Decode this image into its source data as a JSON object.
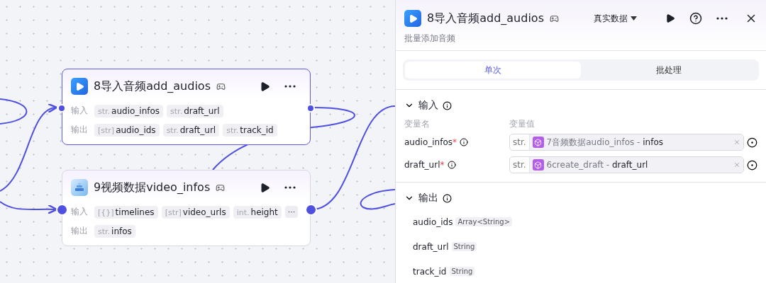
{
  "canvas": {
    "nodes": [
      {
        "title": "8导入音频add_audios",
        "selected": true,
        "rows": [
          {
            "label": "输入",
            "chips": [
              {
                "type": "str.",
                "name": "audio_infos"
              },
              {
                "type": "str.",
                "name": "draft_url"
              }
            ]
          },
          {
            "label": "输出",
            "chips": [
              {
                "type": "[str]",
                "name": "audio_ids"
              },
              {
                "type": "str.",
                "name": "draft_url"
              },
              {
                "type": "str.",
                "name": "track_id"
              }
            ]
          }
        ]
      },
      {
        "title": "9视频数据video_infos",
        "selected": false,
        "rows": [
          {
            "label": "输入",
            "chips": [
              {
                "type": "[{}]",
                "name": "timelines"
              },
              {
                "type": "[str]",
                "name": "video_urls"
              },
              {
                "type": "int.",
                "name": "height"
              }
            ],
            "more_label": "···"
          },
          {
            "label": "输出",
            "chips": [
              {
                "type": "str.",
                "name": "infos"
              }
            ]
          }
        ]
      }
    ]
  },
  "panel": {
    "title": "8导入音频add_audios",
    "subtitle": "批量添加音频",
    "data_mode": "真实数据",
    "tabs": [
      {
        "label": "单次",
        "selected": true
      },
      {
        "label": "批处理",
        "selected": false
      }
    ],
    "input": {
      "title": "输入",
      "expanded": true,
      "col_name": "变量名",
      "col_value": "变量值",
      "rows": [
        {
          "name": "audio_infos",
          "required_mark": "*",
          "type": "str.",
          "reference": "7音频数据audio_infos - **infos**"
        },
        {
          "name": "draft_url",
          "required_mark": "*",
          "type": "str.",
          "reference": "6create_draft - **draft_url**"
        }
      ]
    },
    "output": {
      "title": "输出",
      "expanded": true,
      "rows": [
        {
          "name": "audio_ids",
          "type": "Array<String>"
        },
        {
          "name": "draft_url",
          "type": "String"
        },
        {
          "name": "track_id",
          "type": "String"
        }
      ]
    }
  }
}
